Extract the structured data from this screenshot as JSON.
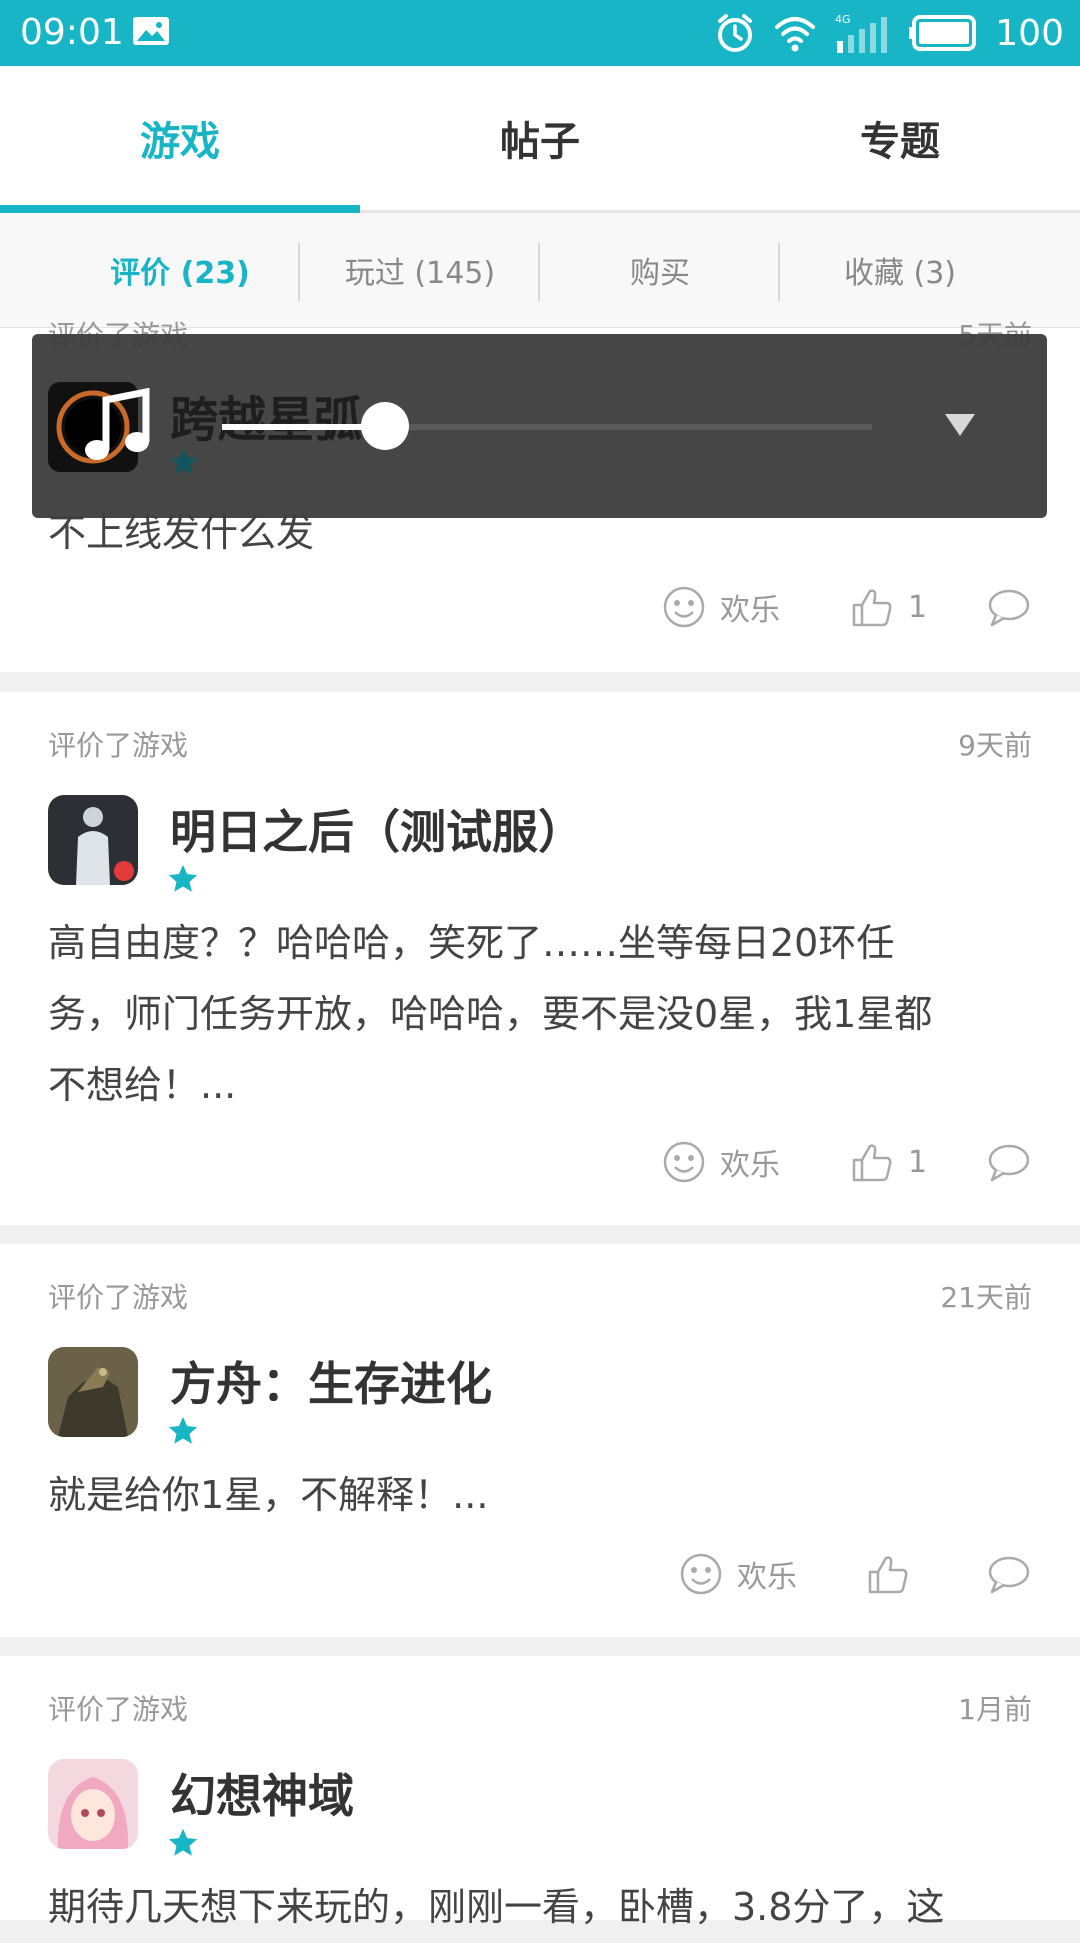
{
  "status_bar": {
    "time": "09:01",
    "network": "4G",
    "battery": "100"
  },
  "top_tabs": [
    "游戏",
    "帖子",
    "专题"
  ],
  "top_tab_active": "游戏",
  "sub_tabs": [
    "评价 (23)",
    "玩过 (145)",
    "购买",
    "收藏 (3)"
  ],
  "sub_tab_active": "评价 (23)",
  "accent_color": "#17b5c5",
  "music_overlay": {
    "title": "跨越星弧",
    "icon": "music-note-icon",
    "progress": 0.25
  },
  "reviews": [
    {
      "kind": "评价了游戏",
      "ago": "5天前",
      "game": "跨越星弧",
      "stars": 1,
      "text": "不上线发什么发",
      "reaction": "欢乐",
      "likes": "1"
    },
    {
      "kind": "评价了游戏",
      "ago": "9天前",
      "game": "明日之后（测试服）",
      "stars": 1,
      "text_lines": [
        "高自由度？？哈哈哈，笑死了……坐等每日20环任",
        "务，师门任务开放，哈哈哈，要不是没0星，我1星都",
        "不想给！..."
      ],
      "reaction": "欢乐",
      "likes": "1"
    },
    {
      "kind": "评价了游戏",
      "ago": "21天前",
      "game": "方舟：生存进化",
      "stars": 1,
      "text": "就是给你1星，不解释！...",
      "reaction": "欢乐",
      "likes": ""
    },
    {
      "kind": "评价了游戏",
      "ago": "1月前",
      "game": "幻想神域",
      "stars": 1,
      "text": "期待几天想下来玩的，刚刚一看，卧槽，3.8分了，这",
      "reaction": "",
      "likes": ""
    }
  ]
}
